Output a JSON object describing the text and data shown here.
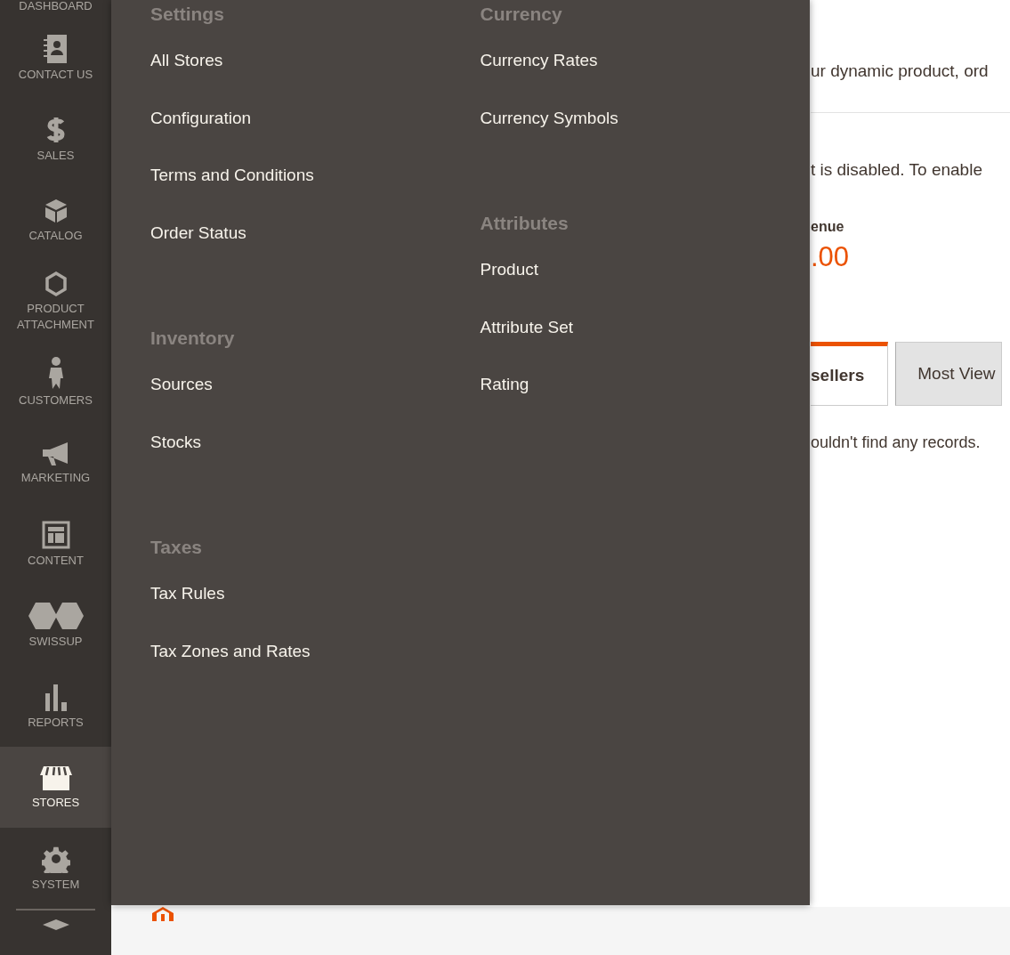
{
  "sidebar": {
    "items": [
      {
        "label": "DASHBOARD",
        "selected": false
      },
      {
        "label": "CONTACT US",
        "selected": false
      },
      {
        "label": "SALES",
        "selected": false
      },
      {
        "label": "CATALOG",
        "selected": false
      },
      {
        "label": "PRODUCT ATTACHMENT",
        "selected": false
      },
      {
        "label": "CUSTOMERS",
        "selected": false
      },
      {
        "label": "MARKETING",
        "selected": false
      },
      {
        "label": "CONTENT",
        "selected": false
      },
      {
        "label": "SWISSUP",
        "selected": false
      },
      {
        "label": "REPORTS",
        "selected": false
      },
      {
        "label": "STORES",
        "selected": true
      },
      {
        "label": "SYSTEM",
        "selected": false
      },
      {
        "selected": false
      }
    ]
  },
  "flyout": {
    "columns": [
      {
        "sections": [
          {
            "title": "Settings",
            "links": [
              "All Stores",
              "Configuration",
              "Terms and Conditions",
              "Order Status"
            ]
          },
          {
            "title": "Inventory",
            "links": [
              "Sources",
              "Stocks"
            ]
          },
          {
            "title": "Taxes",
            "links": [
              "Tax Rules",
              "Tax Zones and Rates"
            ]
          }
        ]
      },
      {
        "sections": [
          {
            "title": "Currency",
            "links": [
              "Currency Rates",
              "Currency Symbols"
            ]
          },
          {
            "title": "Attributes",
            "links": [
              "Product",
              "Attribute Set",
              "Rating"
            ]
          }
        ]
      }
    ]
  },
  "main": {
    "intro": "ur dynamic product, ord",
    "notice": "t is disabled. To enable",
    "revenue_label": "enue",
    "revenue_value": ".00",
    "tabs": [
      {
        "label": "sellers",
        "selected": true
      },
      {
        "label": "Most View",
        "selected": false
      }
    ],
    "empty_message": "ouldn't find any records."
  }
}
